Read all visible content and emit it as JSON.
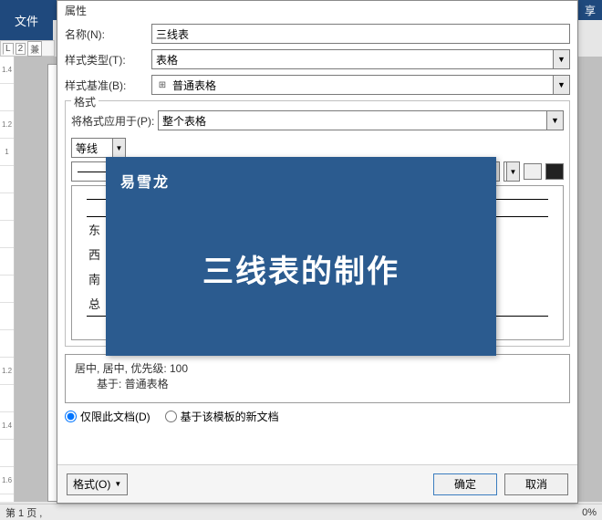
{
  "topbar": {
    "file": "文件",
    "share": "享"
  },
  "tabs": {
    "t1": "L",
    "t2": "2",
    "t3": "兼"
  },
  "ruler": [
    "1.4",
    "",
    "1.2",
    "1",
    "",
    "",
    "",
    "",
    "",
    "",
    "",
    "1.2",
    "",
    "1.4",
    "",
    "1.6"
  ],
  "dialog": {
    "section_props": "属性",
    "name_label": "名称(N):",
    "name_value": "三线表",
    "style_type_label": "样式类型(T):",
    "style_type_value": "表格",
    "based_on_label": "样式基准(B):",
    "based_on_icon": "⊞",
    "based_on_value": "普通表格",
    "format_group": "格式",
    "apply_label": "将格式应用于(P):",
    "apply_value": "整个表格",
    "font_combo": "等线",
    "preview_rows": [
      "东",
      "西",
      "南",
      "总"
    ],
    "desc_line1": "居中, 居中, 优先级: 100",
    "desc_line2": "基于: 普通表格",
    "radio_doc": "仅限此文档(D)",
    "radio_tpl": "基于该模板的新文档",
    "format_btn": "格式(O)",
    "ok": "确定",
    "cancel": "取消"
  },
  "overlay": {
    "logo": "易雪龙",
    "title": "三线表的制作"
  },
  "status": {
    "left": "第 1 页 ,",
    "right": "0%"
  }
}
